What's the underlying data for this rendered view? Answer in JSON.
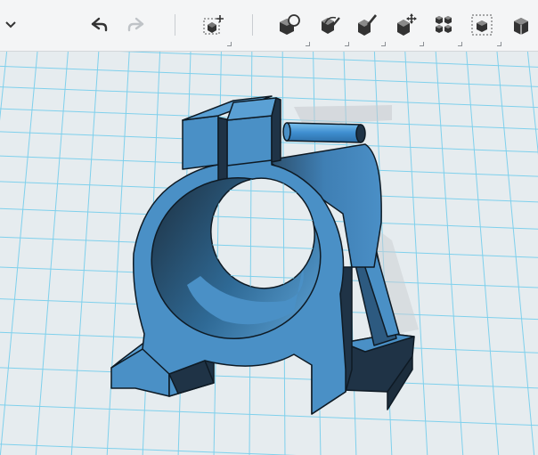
{
  "toolbar": {
    "tools": [
      {
        "icon": "chevron-down-icon"
      },
      {
        "icon": "undo-icon"
      },
      {
        "icon": "redo-icon",
        "state": "disabled"
      },
      {
        "icon": "transform-icon"
      },
      {
        "icon": "primitives-icon"
      },
      {
        "icon": "sketch-icon"
      },
      {
        "icon": "modify-icon"
      },
      {
        "icon": "move-icon"
      },
      {
        "icon": "pattern-icon"
      },
      {
        "icon": "grouping-icon"
      },
      {
        "icon": "combine-icon"
      }
    ]
  },
  "viewport": {
    "background_color": "#e6ecef",
    "grid_color": "#7fd0ec",
    "model_color": "#4a90c6",
    "model_shadow_color": "#1f3346",
    "model": "pillow-block-bracket-with-pin"
  }
}
